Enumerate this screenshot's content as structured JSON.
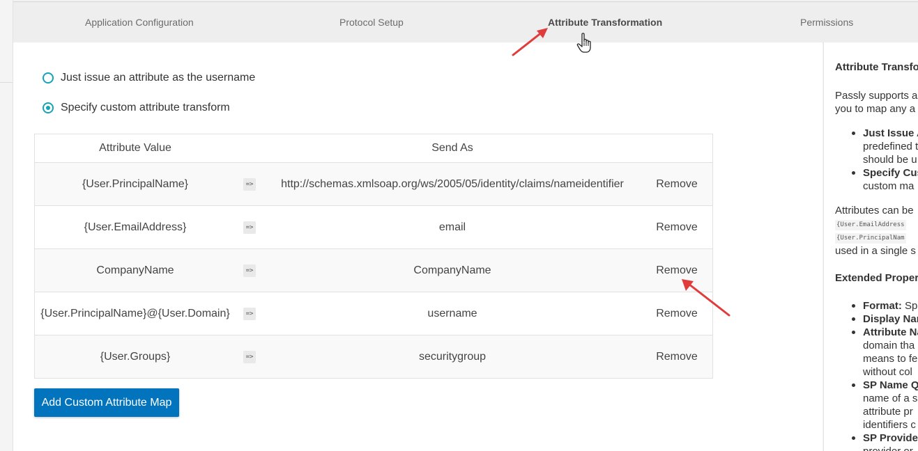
{
  "tabs": [
    {
      "label": "Application Configuration"
    },
    {
      "label": "Protocol Setup"
    },
    {
      "label": "Attribute Transformation"
    },
    {
      "label": "Permissions"
    }
  ],
  "options": [
    {
      "label": "Just issue an attribute as the username",
      "checked": false
    },
    {
      "label": "Specify custom attribute transform",
      "checked": true
    }
  ],
  "table": {
    "headers": {
      "value": "Attribute Value",
      "send": "Send As"
    },
    "arrow": "=>",
    "remove_label": "Remove",
    "rows": [
      {
        "value": "{User.PrincipalName}",
        "send": "http://schemas.xmlsoap.org/ws/2005/05/identity/claims/nameidentifier"
      },
      {
        "value": "{User.EmailAddress}",
        "send": "email"
      },
      {
        "value": "CompanyName",
        "send": "CompanyName"
      },
      {
        "value": "{User.PrincipalName}@{User.Domain}",
        "send": "username"
      },
      {
        "value": "{User.Groups}",
        "send": "securitygroup"
      }
    ]
  },
  "add_button_label": "Add Custom Attribute Map",
  "help": {
    "title": "Attribute Transfo",
    "intro_line1": "Passly supports a",
    "intro_line2": "you to map any a",
    "bullets1": [
      {
        "term": "Just Issue A",
        "lines": [
          "predefined t",
          "should be u"
        ]
      },
      {
        "term": "Specify Cus",
        "lines": [
          "custom ma"
        ]
      }
    ],
    "attrs_line1": "Attributes can be",
    "code1": "{User.EmailAddress",
    "code2": "{User.PrincipalNam",
    "attrs_line2": "used in a single s",
    "ext_title": "Extended Proper",
    "bullets2": [
      {
        "term": "Format:",
        "rest": " Spe",
        "lines": []
      },
      {
        "term": "Display Nam",
        "rest": "",
        "lines": []
      },
      {
        "term": "Attribute Na",
        "rest": "",
        "lines": [
          "domain tha",
          "means to fe",
          "without col"
        ]
      },
      {
        "term": "SP Name Q",
        "rest": "",
        "lines": [
          "name of a s",
          "attribute pr",
          "identifiers c"
        ]
      },
      {
        "term": "SP Provide",
        "rest": "",
        "lines": [
          "provider or"
        ]
      }
    ]
  }
}
